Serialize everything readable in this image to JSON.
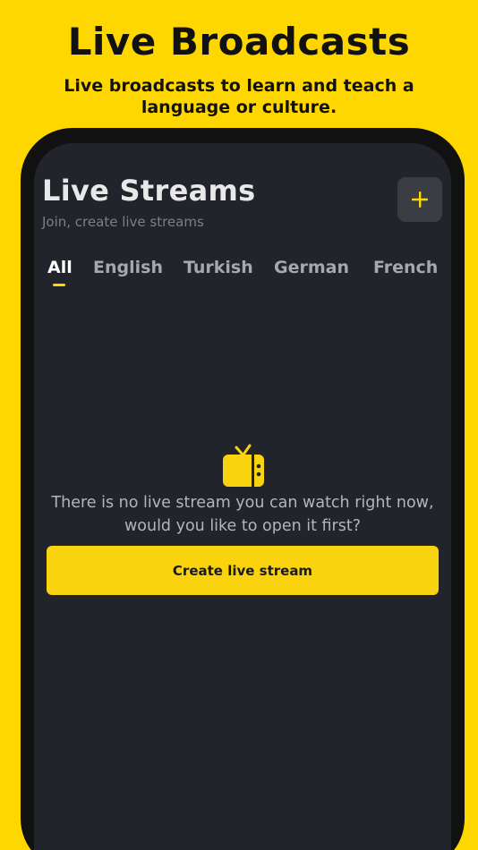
{
  "promo": {
    "title": "Live Broadcasts",
    "subtitle": "Live broadcasts to learn and teach a language or culture."
  },
  "header": {
    "title": "Live Streams",
    "subtitle": "Join, create live streams",
    "add_icon": "plus-icon"
  },
  "tabs": [
    {
      "label": "All",
      "active": true
    },
    {
      "label": "English",
      "active": false
    },
    {
      "label": "Turkish",
      "active": false
    },
    {
      "label": "German",
      "active": false
    },
    {
      "label": "French",
      "active": false
    }
  ],
  "empty_state": {
    "icon": "tv-icon",
    "message_line1": "There is no live stream you can watch right now,",
    "message_line2": "would you like to open it first?",
    "button_label": "Create live stream"
  },
  "colors": {
    "accent": "#FFD700",
    "screen_bg": "#21242B",
    "frame": "#111111",
    "button": "#F8D30E"
  }
}
